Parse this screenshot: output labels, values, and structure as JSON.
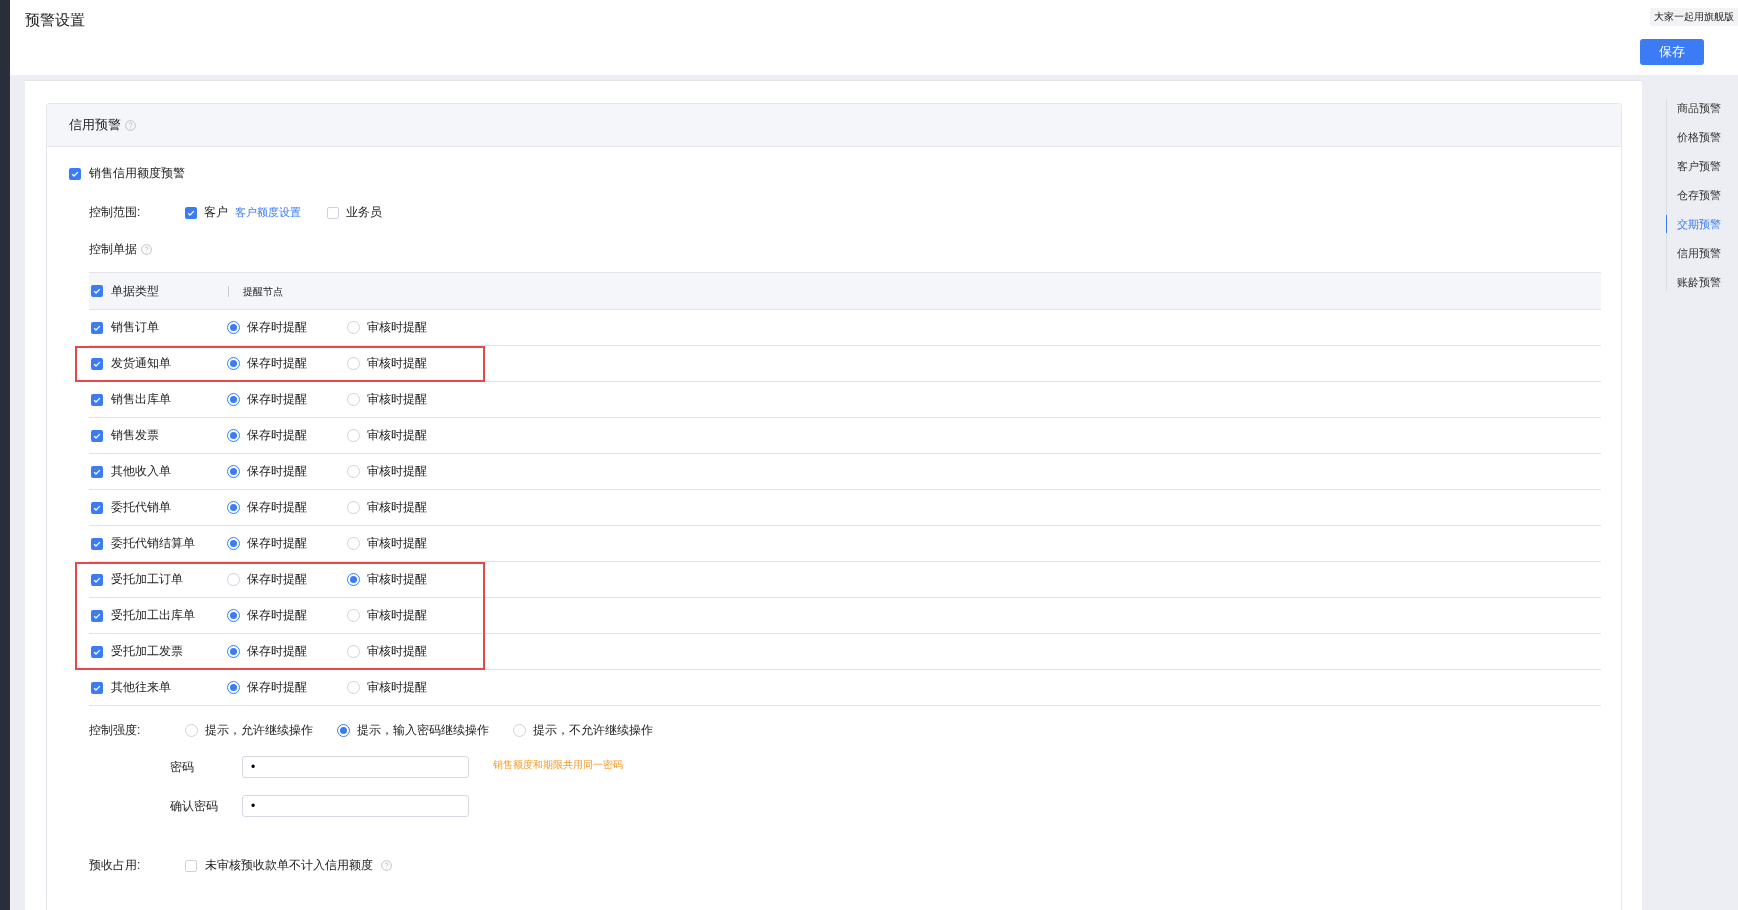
{
  "header": {
    "title": "预警设置",
    "banner": "大家一起用旗舰版",
    "save_button": "保存"
  },
  "section": {
    "title": "信用预警",
    "master": {
      "label": "销售信用额度预警",
      "checked": true
    },
    "scope": {
      "label": "控制范围:",
      "options": [
        {
          "label": "客户",
          "checked": true,
          "link": "客户额度设置"
        },
        {
          "label": "业务员",
          "checked": false
        }
      ]
    },
    "docs_label": "控制单据",
    "table": {
      "header_checked": true,
      "columns": [
        "单据类型",
        "提醒节点"
      ],
      "rows": [
        {
          "name": "销售订单",
          "checked": true,
          "highlighted": false,
          "options": [
            {
              "label": "保存时提醒",
              "selected": true
            },
            {
              "label": "审核时提醒",
              "selected": false
            }
          ]
        },
        {
          "name": "发货通知单",
          "checked": true,
          "highlighted": true,
          "options": [
            {
              "label": "保存时提醒",
              "selected": true
            },
            {
              "label": "审核时提醒",
              "selected": false
            }
          ]
        },
        {
          "name": "销售出库单",
          "checked": true,
          "highlighted": false,
          "options": [
            {
              "label": "保存时提醒",
              "selected": true
            },
            {
              "label": "审核时提醒",
              "selected": false
            }
          ]
        },
        {
          "name": "销售发票",
          "checked": true,
          "highlighted": false,
          "options": [
            {
              "label": "保存时提醒",
              "selected": true
            },
            {
              "label": "审核时提醒",
              "selected": false
            }
          ]
        },
        {
          "name": "其他收入单",
          "checked": true,
          "highlighted": false,
          "options": [
            {
              "label": "保存时提醒",
              "selected": true
            },
            {
              "label": "审核时提醒",
              "selected": false
            }
          ]
        },
        {
          "name": "委托代销单",
          "checked": true,
          "highlighted": false,
          "options": [
            {
              "label": "保存时提醒",
              "selected": true
            },
            {
              "label": "审核时提醒",
              "selected": false
            }
          ]
        },
        {
          "name": "委托代销结算单",
          "checked": true,
          "highlighted": false,
          "options": [
            {
              "label": "保存时提醒",
              "selected": true
            },
            {
              "label": "审核时提醒",
              "selected": false
            }
          ]
        },
        {
          "name": "受托加工订单",
          "checked": true,
          "highlighted": true,
          "options": [
            {
              "label": "保存时提醒",
              "selected": false
            },
            {
              "label": "审核时提醒",
              "selected": true
            }
          ]
        },
        {
          "name": "受托加工出库单",
          "checked": true,
          "highlighted": true,
          "options": [
            {
              "label": "保存时提醒",
              "selected": true
            },
            {
              "label": "审核时提醒",
              "selected": false
            }
          ]
        },
        {
          "name": "受托加工发票",
          "checked": true,
          "highlighted": true,
          "options": [
            {
              "label": "保存时提醒",
              "selected": true
            },
            {
              "label": "审核时提醒",
              "selected": false
            }
          ]
        },
        {
          "name": "其他往来单",
          "checked": true,
          "highlighted": false,
          "options": [
            {
              "label": "保存时提醒",
              "selected": true
            },
            {
              "label": "审核时提醒",
              "selected": false
            }
          ]
        }
      ]
    },
    "strength": {
      "label": "控制强度:",
      "options": [
        {
          "label": "提示，允许继续操作",
          "selected": false
        },
        {
          "label": "提示，输入密码继续操作",
          "selected": true
        },
        {
          "label": "提示，不允许继续操作",
          "selected": false
        }
      ]
    },
    "passwords": [
      {
        "label": "密码",
        "value": "•",
        "hint": "销售额度和期限共用同一密码"
      },
      {
        "label": "确认密码",
        "value": "•"
      }
    ],
    "prepaid": {
      "label": "预收占用:",
      "option": "未审核预收款单不计入信用额度",
      "checked": false
    }
  },
  "nav": {
    "items": [
      {
        "label": "商品预警",
        "selected": false
      },
      {
        "label": "价格预警",
        "selected": false
      },
      {
        "label": "客户预警",
        "selected": false
      },
      {
        "label": "仓存预警",
        "selected": false
      },
      {
        "label": "交期预警",
        "selected": true
      },
      {
        "label": "信用预警",
        "selected": false
      },
      {
        "label": "账龄预警",
        "selected": false
      }
    ]
  }
}
